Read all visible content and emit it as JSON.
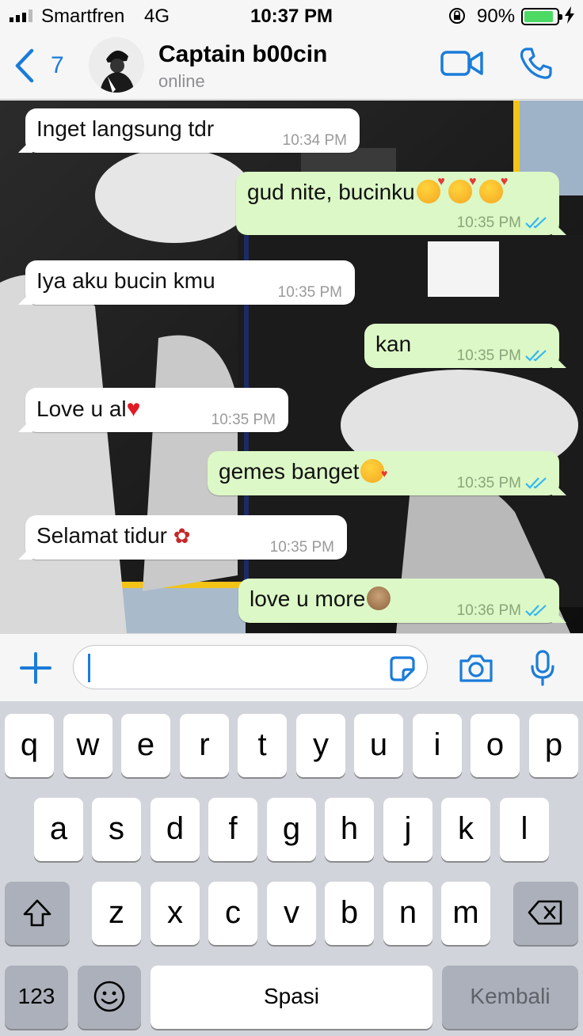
{
  "status_bar": {
    "carrier": "Smartfren",
    "network": "4G",
    "time": "10:37 PM",
    "battery_percent": "90%",
    "battery_level": 0.9,
    "icons": [
      "signal-icon",
      "orientation-lock-icon",
      "battery-icon",
      "charging-icon"
    ]
  },
  "header": {
    "back_count": "7",
    "contact_name": "Captain b00cin",
    "contact_status": "online",
    "icons": [
      "chevron-left-icon",
      "video-call-icon",
      "phone-icon"
    ]
  },
  "messages": [
    {
      "direction": "incoming",
      "text": "Inget langsung tdr",
      "time": "10:34 PM"
    },
    {
      "direction": "outgoing",
      "text": "gud nite, bucinku",
      "emoji": "smiling-face-with-hearts x3",
      "time": "10:35 PM",
      "read": true
    },
    {
      "direction": "incoming",
      "text": "Iya aku bucin kmu",
      "time": "10:35 PM"
    },
    {
      "direction": "outgoing",
      "text": "kan",
      "time": "10:35 PM",
      "read": true
    },
    {
      "direction": "incoming",
      "text": "Love u al",
      "emoji": "red-heart",
      "time": "10:35 PM"
    },
    {
      "direction": "outgoing",
      "text": "gemes banget",
      "emoji": "face-blowing-kiss",
      "time": "10:35 PM",
      "read": true
    },
    {
      "direction": "incoming",
      "text": "Selamat tidur ",
      "emoji": "rose",
      "time": "10:35 PM"
    },
    {
      "direction": "outgoing",
      "text": "love u more",
      "emoji": "see-no-evil-monkey",
      "time": "10:36 PM",
      "read": true
    }
  ],
  "input_bar": {
    "value": "",
    "icons": [
      "plus-icon",
      "sticker-icon",
      "camera-icon",
      "microphone-icon"
    ]
  },
  "keyboard": {
    "row1": [
      "q",
      "w",
      "e",
      "r",
      "t",
      "y",
      "u",
      "i",
      "o",
      "p"
    ],
    "row2": [
      "a",
      "s",
      "d",
      "f",
      "g",
      "h",
      "j",
      "k",
      "l"
    ],
    "row3": [
      "z",
      "x",
      "c",
      "v",
      "b",
      "n",
      "m"
    ],
    "numbers_label": "123",
    "space_label": "Spasi",
    "return_label": "Kembali",
    "icons": [
      "shift-icon",
      "delete-icon",
      "emoji-icon"
    ]
  },
  "colors": {
    "accent": "#1a7cd9",
    "outgoing_bubble": "#dcf8c6",
    "incoming_bubble": "#ffffff",
    "read_ticks": "#34b7f1",
    "battery": "#4cd964"
  }
}
